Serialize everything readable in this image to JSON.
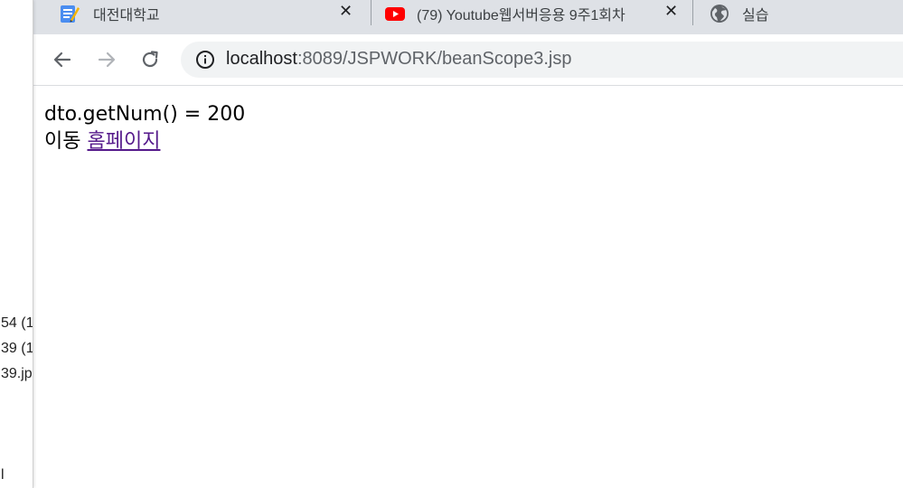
{
  "left_window": {
    "fragments": [
      "54 (1",
      "39 (1",
      "39.jp",
      "l"
    ]
  },
  "tabs": [
    {
      "title": "대전대학교",
      "icon": "notepad-icon"
    },
    {
      "title": "(79) Youtube웹서버응용 9주1회차",
      "icon": "youtube-icon"
    },
    {
      "title": "실습",
      "icon": "globe-icon"
    }
  ],
  "toolbar": {
    "url_host": "localhost",
    "url_rest": ":8089/JSPWORK/beanScope3.jsp"
  },
  "content": {
    "line1": "dto.getNum() = 200",
    "move_label": "이동",
    "link_text": "홈페이지"
  },
  "colors": {
    "tab_bar": "#dee1e6",
    "link_visited": "#551a8b",
    "youtube_red": "#ff0000"
  }
}
